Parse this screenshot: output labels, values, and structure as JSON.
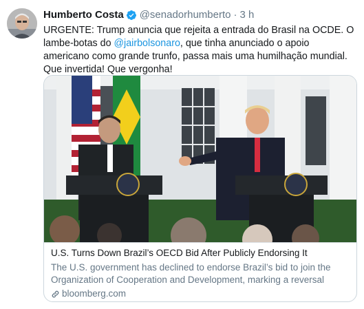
{
  "user": {
    "name": "Humberto Costa",
    "handle": "@senadorhumberto",
    "separator": "·",
    "time": "3 h",
    "verified_icon": "verified-badge-icon"
  },
  "tweet": {
    "text_before": "URGENTE: Trump anuncia que rejeita a entrada do Brasil na OCDE. O lambe-botas do ",
    "mention": "@jairbolsonaro",
    "text_after": ", que tinha anunciado o apoio americano como grande trunfo, passa mais uma humilhação mundial. Que invertida! Que vergonha!"
  },
  "card": {
    "title": "U.S. Turns Down Brazil’s OECD Bid After Publicly Endorsing It",
    "description": "The U.S. government has declined to endorse Brazil’s bid to join the Organization of Cooperation and Development, marking a reversal after...",
    "domain": "bloomberg.com",
    "link_icon": "link-icon"
  },
  "colors": {
    "accent": "#1b95e0",
    "secondary_text": "#657786",
    "border": "#ccd6dd"
  }
}
